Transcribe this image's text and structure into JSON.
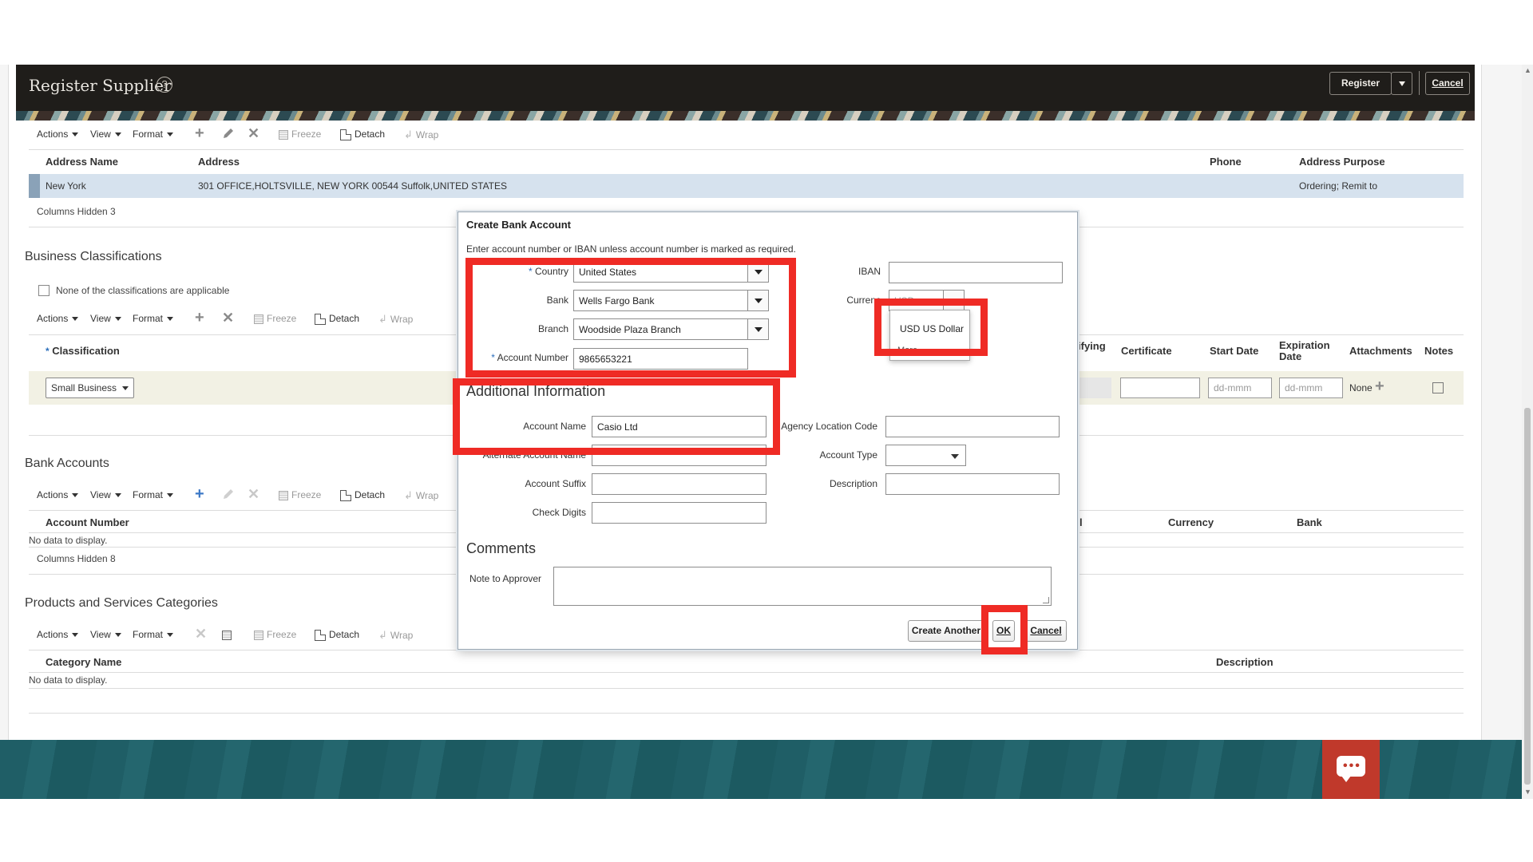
{
  "header": {
    "title": "Register Supplier",
    "help_icon": "?",
    "register_label": "Register",
    "cancel_label": "Cancel"
  },
  "toolbar": {
    "actions": "Actions",
    "view": "View",
    "format": "Format",
    "freeze": "Freeze",
    "detach": "Detach",
    "wrap": "Wrap"
  },
  "addresses": {
    "columns": [
      "Address Name",
      "Address",
      "Phone",
      "Address Purpose"
    ],
    "row": {
      "address_name": "New York",
      "address": "301 OFFICE,HOLTSVILLE, NEW YORK 00544 Suffolk,UNITED STATES",
      "phone": "",
      "address_purpose": "Ordering; Remit to"
    },
    "columns_hidden": "Columns Hidden  3"
  },
  "business_classifications": {
    "title": "Business Classifications",
    "none_applicable": "None of the classifications are applicable",
    "columns": [
      "Classification",
      "ifying",
      "Certificate",
      "Start Date",
      "Expiration Date",
      "Attachments",
      "Notes"
    ],
    "row": {
      "classification": "Small Business",
      "start_date_placeholder": "dd-mmm",
      "expiration_placeholder": "dd-mmm",
      "attachments": "None"
    }
  },
  "bank_accounts": {
    "title": "Bank Accounts",
    "columns": [
      "Account Number",
      "Currency",
      "Bank"
    ],
    "no_data": "No data to display.",
    "columns_hidden": "Columns Hidden  8"
  },
  "products_services": {
    "title": "Products and Services Categories",
    "columns": [
      "Category Name",
      "Description"
    ],
    "no_data": "No data to display."
  },
  "dialog": {
    "title": "Create Bank Account",
    "instruction": "Enter account number or IBAN unless account number is marked as required.",
    "country_label": "Country",
    "country_value": "United States",
    "bank_label": "Bank",
    "bank_value": "Wells Fargo Bank",
    "branch_label": "Branch",
    "branch_value": "Woodside Plaza Branch",
    "account_number_label": "Account Number",
    "account_number_value": "9865653221",
    "iban_label": "IBAN",
    "iban_value": "",
    "currency_label": "Currenc",
    "currency_value": "USD",
    "currency_options": [
      "USD US Dollar",
      "More..."
    ],
    "additional_info_title": "Additional Information",
    "account_name_label": "Account Name",
    "account_name_value": "Casio Ltd",
    "alternate_account_name_label": "Alternate Account Name",
    "agency_location_code_label": "Agency Location Code",
    "account_type_label": "Account Type",
    "account_suffix_label": "Account Suffix",
    "description_label": "Description",
    "check_digits_label": "Check Digits",
    "comments_title": "Comments",
    "note_to_approver_label": "Note to Approver",
    "create_another_label": "Create Another",
    "ok_label": "OK",
    "cancel_label": "Cancel"
  },
  "colors": {
    "header_bg": "#1f1d1a",
    "highlight_red": "#ef2b25",
    "footer_teal": "#1f5e66",
    "chat_red": "#c0392b",
    "selected_row": "#d6e2ee"
  },
  "icons": [
    "help-icon",
    "plus-icon",
    "pencil-icon",
    "delete-icon",
    "freeze-icon",
    "detach-icon",
    "wrap-icon",
    "chevron-down-icon",
    "attachment-add-icon",
    "notes-edit-icon",
    "chat-icon"
  ]
}
